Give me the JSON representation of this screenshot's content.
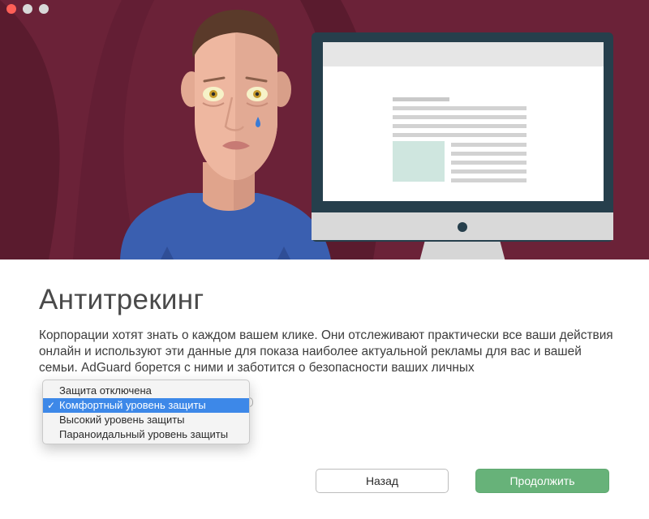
{
  "window": {
    "controls": {
      "close_color": "#fe5f57",
      "minimize_color": "#d8d8d8",
      "maximize_color": "#d8d8d8"
    }
  },
  "hero": {
    "background_color": "#6b2238",
    "illustration": "crying-man-and-monitor"
  },
  "page": {
    "title": "Антитрекинг",
    "description": "Корпорации хотят знать о каждом вашем клике. Они отслеживают практически все ваши действия онлайн и используют эти данные для показа наиболее актуальной рекламы для вас и вашей семьи. AdGuard борется с ними и заботится о безопасности ваших личных"
  },
  "protection_dropdown": {
    "selected": "Комфортный уровень защиты",
    "options": [
      {
        "label": "Защита отключена",
        "checked": false
      },
      {
        "label": "Комфортный уровень защиты",
        "checked": true
      },
      {
        "label": "Высокий уровень защиты",
        "checked": false
      },
      {
        "label": "Параноидальный уровень защиты",
        "checked": false
      }
    ],
    "check_mark": "✓",
    "highlight_color": "#3d88e8"
  },
  "buttons": {
    "back_label": "Назад",
    "continue_label": "Продолжить",
    "continue_color": "#67b279"
  }
}
